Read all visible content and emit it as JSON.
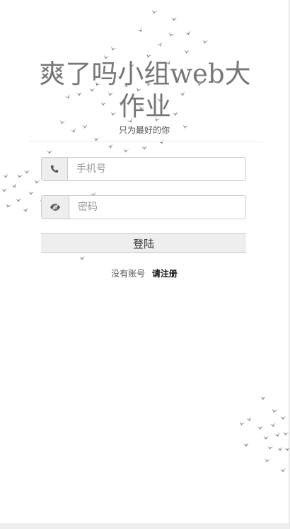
{
  "header": {
    "title": "爽了吗小组web大作业",
    "subtitle": "只为最好的你"
  },
  "form": {
    "phone": {
      "placeholder": "手机号",
      "value": "",
      "icon": "phone-icon"
    },
    "password": {
      "placeholder": "密码",
      "value": "",
      "icon": "eye-icon"
    },
    "login_label": "登陆"
  },
  "footer": {
    "prompt": "没有账号",
    "register_label": "请注册"
  },
  "colors": {
    "bird": "#8a8a8a",
    "addon_bg": "#eeeeee",
    "button_bg": "#eeeeee",
    "border": "#cccccc"
  }
}
